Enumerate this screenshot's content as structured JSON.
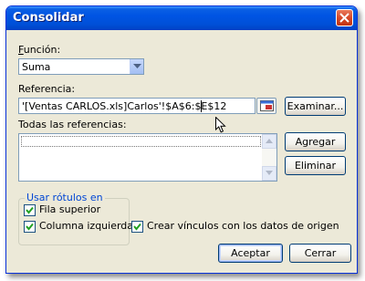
{
  "window": {
    "title": "Consolidar"
  },
  "function": {
    "label": "Función:",
    "value": "Suma"
  },
  "reference": {
    "label": "Referencia:",
    "value": "'[Ventas CARLOS.xls]Carlos'!$A$6:$E$12"
  },
  "all_references": {
    "label": "Todas las referencias:",
    "items": []
  },
  "buttons": {
    "browse": "Examinar...",
    "add": "Agregar",
    "delete": "Eliminar",
    "accept": "Aceptar",
    "close": "Cerrar"
  },
  "labels_group": {
    "title": "Usar rótulos en",
    "top_row": {
      "label": "Fila superior",
      "checked": true
    },
    "left_column": {
      "label": "Columna izquierda",
      "checked": true
    }
  },
  "create_links": {
    "label": "Crear vínculos con los datos de origen",
    "checked": true
  },
  "colors": {
    "title_bar": "#0054e3",
    "dialog_bg": "#ece9d8",
    "close_button": "#d7492a",
    "group_title": "#0046d5"
  }
}
